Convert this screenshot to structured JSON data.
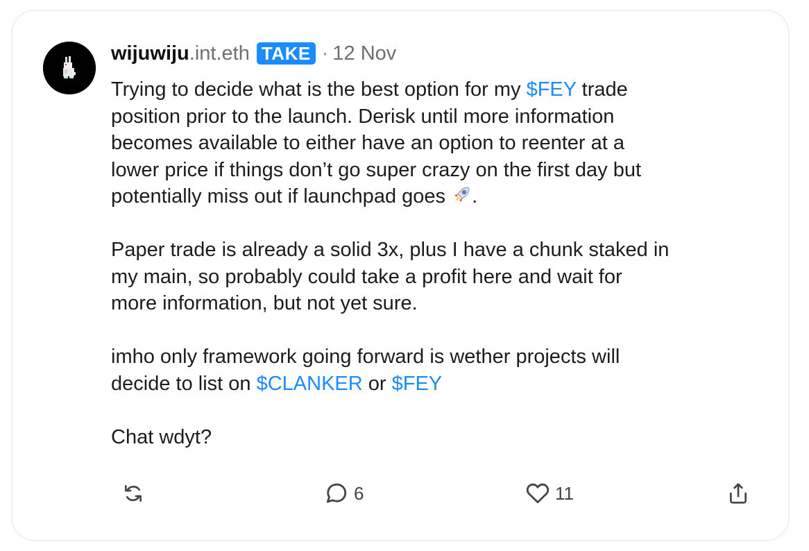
{
  "post": {
    "author": {
      "username": "wijuwiju",
      "domain": ".int.eth",
      "badge": "TAKE",
      "avatar_icon": "pixel-rabbit-icon"
    },
    "separator": "·",
    "date": "12 Nov",
    "body": {
      "p1_l1_pre": "Trying to decide what is the best option for my ",
      "p1_l1_tag": "$FEY",
      "p1_l1_post": " trade",
      "p1_l2": "position prior to the launch. Derisk until more information",
      "p1_l3": "becomes available to either have an option to reenter at a",
      "p1_l4": "lower price if things don’t go super crazy on the first day but",
      "p1_l5_pre": "potentially miss out if launchpad goes ",
      "p1_l5_emoji": "rocket-icon",
      "p1_l5_post": ".",
      "p2_l1": "Paper trade is already a solid 3x, plus I have a chunk staked in",
      "p2_l2": "my main, so probably could take a profit here and wait for",
      "p2_l3": "more information, but not yet sure.",
      "p3_l1": "imho only framework going forward is wether projects will",
      "p3_l2_pre": "decide to list on ",
      "p3_l2_tag1": "$CLANKER",
      "p3_l2_mid": " or ",
      "p3_l2_tag2": "$FEY",
      "p4_l1": "Chat wdyt?"
    },
    "colors": {
      "accent": "#1a8cff",
      "text": "#1c1c1e",
      "muted": "#6e6e73"
    },
    "actions": {
      "recast": {
        "icon": "recast-icon"
      },
      "reply": {
        "icon": "reply-icon",
        "count": "6"
      },
      "like": {
        "icon": "heart-icon",
        "count": "11"
      },
      "share": {
        "icon": "share-icon"
      }
    }
  }
}
